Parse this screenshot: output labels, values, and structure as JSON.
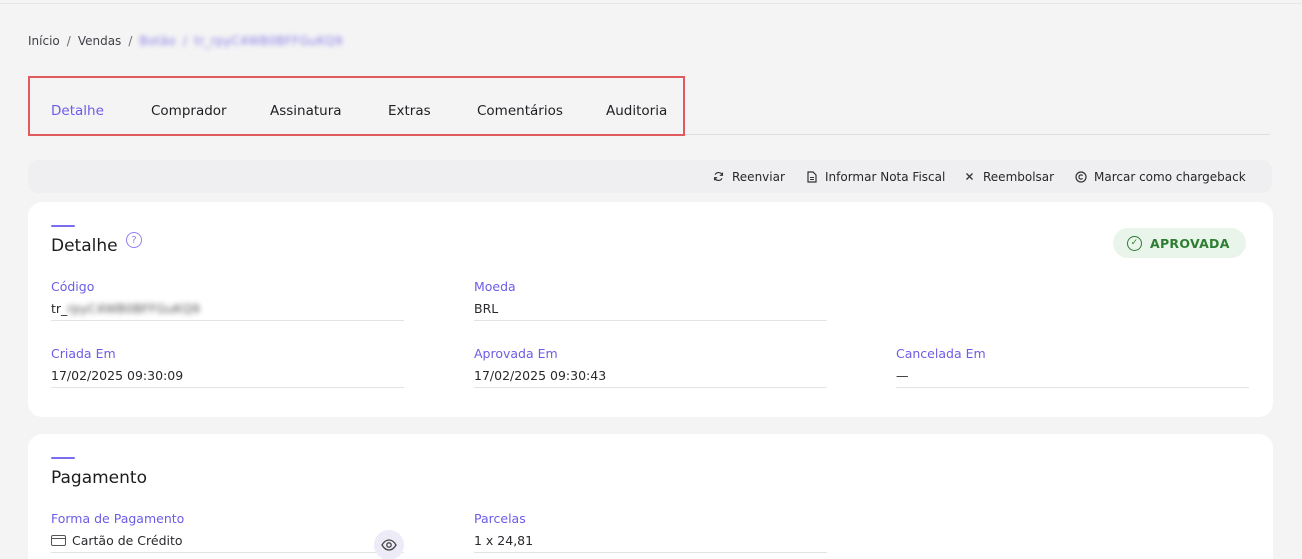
{
  "breadcrumb": {
    "items": [
      "Início",
      "Vendas",
      "Botão",
      "tr_rpyC4WB0BFFGuKQ9"
    ],
    "separator": "/"
  },
  "tabs": [
    {
      "label": "Detalhe",
      "active": true
    },
    {
      "label": "Comprador",
      "active": false
    },
    {
      "label": "Assinatura",
      "active": false
    },
    {
      "label": "Extras",
      "active": false
    },
    {
      "label": "Comentários",
      "active": false
    },
    {
      "label": "Auditoria",
      "active": false
    }
  ],
  "actions": [
    {
      "label": "Reenviar",
      "icon": "refresh-icon"
    },
    {
      "label": "Informar Nota Fiscal",
      "icon": "document-icon"
    },
    {
      "label": "Reembolsar",
      "icon": "close-icon"
    },
    {
      "label": "Marcar como chargeback",
      "icon": "copyright-icon"
    }
  ],
  "detail": {
    "title": "Detalhe",
    "status": "APROVADA",
    "status_color": "#2e7d32",
    "fields": [
      {
        "label": "Código",
        "value_prefix": "tr_",
        "value_blurred": "rpyC4WB0BFFGuKQ9"
      },
      {
        "label": "Moeda",
        "value": "BRL"
      },
      {
        "label": "Criada Em",
        "value": "17/02/2025 09:30:09"
      },
      {
        "label": "Aprovada Em",
        "value": "17/02/2025 09:30:43"
      },
      {
        "label": "Cancelada Em",
        "value": "—"
      }
    ]
  },
  "payment": {
    "title": "Pagamento",
    "fields": [
      {
        "label": "Forma de Pagamento",
        "value": "Cartão de Crédito",
        "icon": "credit-card-icon"
      },
      {
        "label": "Parcelas",
        "value": "1 x 24,81"
      }
    ]
  },
  "colors": {
    "accent": "#6c5ce7",
    "highlight_border": "#e05a5e",
    "success": "#2e7d32"
  }
}
